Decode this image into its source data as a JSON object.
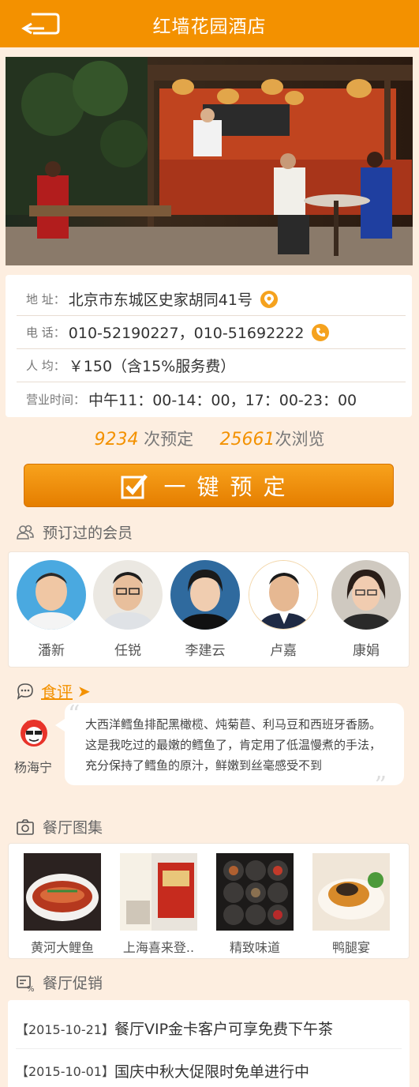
{
  "header": {
    "title": "红墙花园酒店",
    "back_icon": "back-arrow-icon"
  },
  "hero": {
    "description_icon": "restaurant-photo"
  },
  "info": {
    "address_label": "地 址：",
    "address": "北京市东城区史家胡同41号",
    "phone_label": "电 话：",
    "phone": "010-52190227，010-51692222",
    "price_label": "人 均：",
    "price": "￥150（含15%服务费）",
    "hours_label": "营业时间：",
    "hours": "中午11：00-14：00，17：00-23：00"
  },
  "stats": {
    "bookings_count": "9234",
    "bookings_label": "次预定",
    "views_count": "25661",
    "views_label": "次浏览"
  },
  "book_button": {
    "label": "一键预定"
  },
  "members": {
    "title": "预订过的会员",
    "items": [
      {
        "name": "潘新"
      },
      {
        "name": "任锐"
      },
      {
        "name": "李建云"
      },
      {
        "name": "卢嘉"
      },
      {
        "name": "康娟"
      }
    ]
  },
  "review": {
    "title": "食评",
    "reviewer": "杨海宁",
    "text_line1": "大西洋鳕鱼排配黑橄榄、炖菊苣、利马豆和西班牙香肠。",
    "text_line2": "这是我吃过的最嫩的鳕鱼了，肯定用了低温慢煮的手法，",
    "text_line3": "充分保持了鳕鱼的原汁，鲜嫩到丝毫感受不到"
  },
  "gallery": {
    "title": "餐厅图集",
    "items": [
      {
        "name": "黄河大鲤鱼"
      },
      {
        "name": "上海喜来登.."
      },
      {
        "name": "精致味道"
      },
      {
        "name": "鸭腿宴"
      }
    ]
  },
  "promos": {
    "title": "餐厅促销",
    "items": [
      {
        "date": "【2015-10-21】",
        "text": "餐厅VIP金卡客户可享免费下午茶"
      },
      {
        "date": "【2015-10-01】",
        "text": "国庆中秋大促限时免单进行中"
      }
    ]
  },
  "colors": {
    "accent": "#f39100",
    "background": "#fdeee0"
  }
}
